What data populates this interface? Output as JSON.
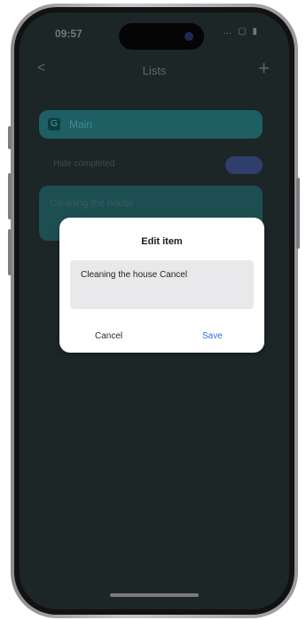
{
  "status_bar": {
    "time": "09:57",
    "icons": "… ▢ ▮"
  },
  "nav": {
    "back_icon": "chevron-left-icon",
    "back_glyph": "<",
    "title": "Lists",
    "add_glyph": "+"
  },
  "list": {
    "header_label": "Main",
    "header_icon_glyph": "G",
    "toggle_label": "Hide completed",
    "items": [
      {
        "text": "Cleaning the house"
      }
    ]
  },
  "dialog": {
    "title": "Edit item",
    "input_value": "Cleaning the house Cancel",
    "cancel_label": "Cancel",
    "save_label": "Save"
  },
  "colors": {
    "accent": "#2e6fd6",
    "list_header": "#1d5f63"
  }
}
